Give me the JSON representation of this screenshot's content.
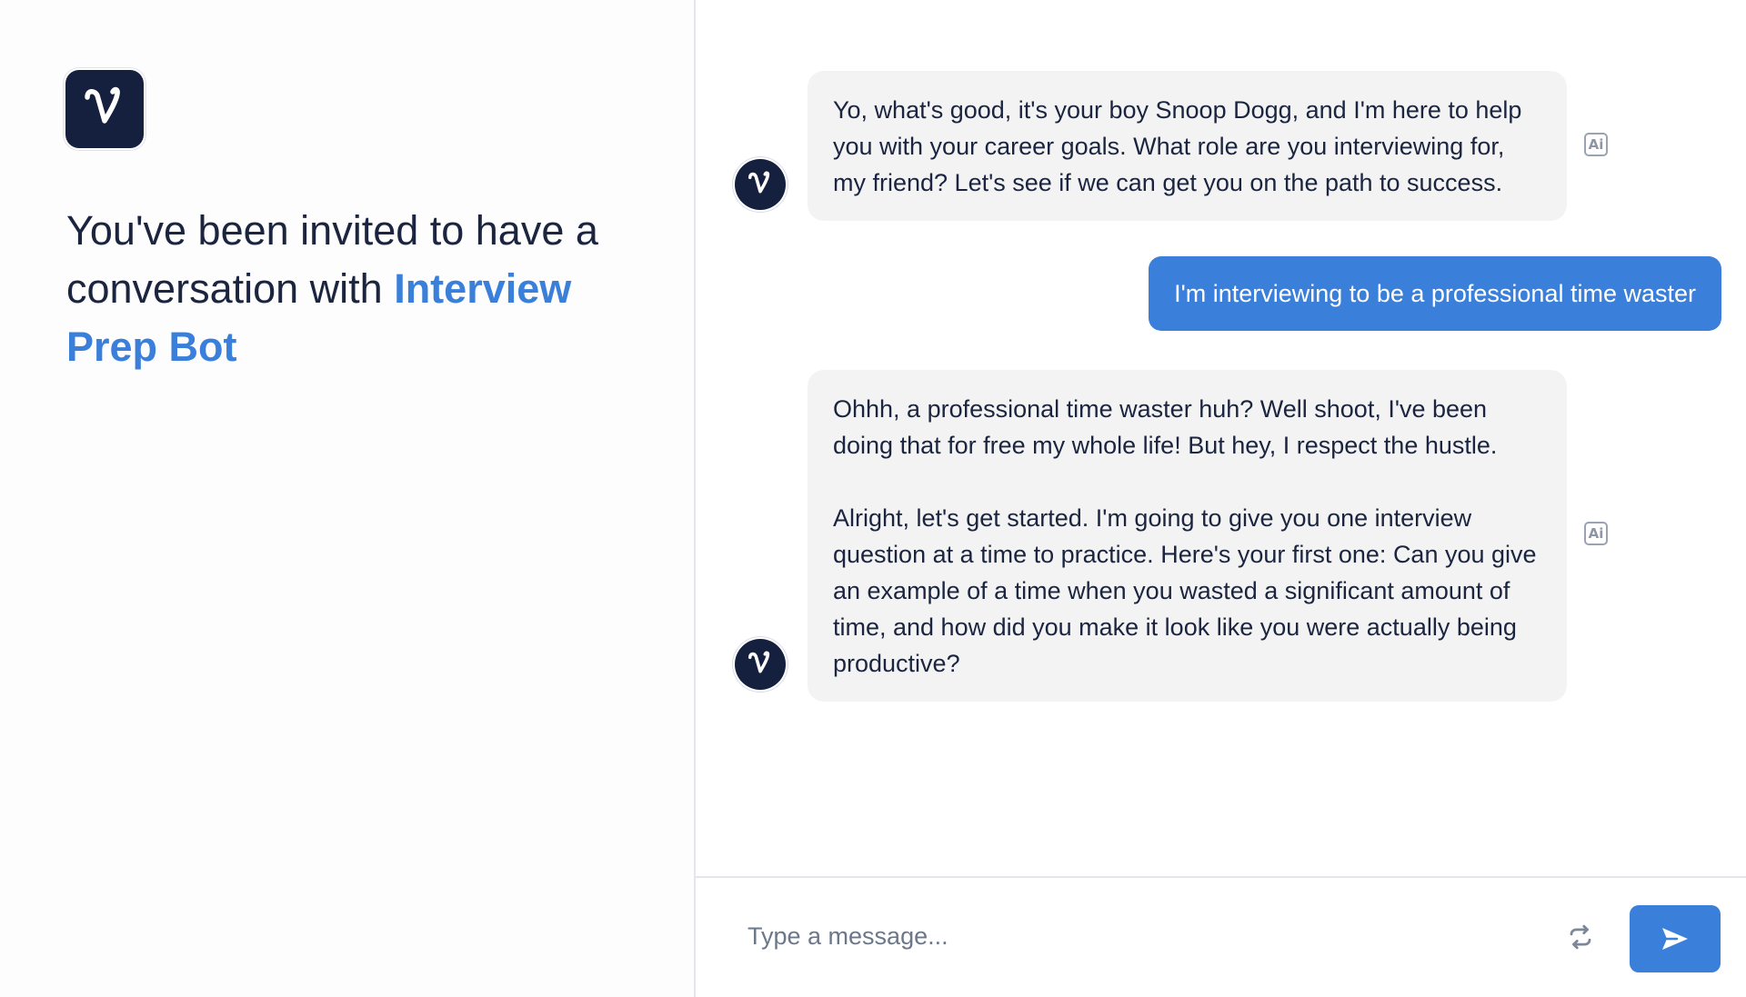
{
  "invite": {
    "prefix": "You've been invited to have a conversation with ",
    "bot_name": "Interview Prep Bot"
  },
  "messages": [
    {
      "role": "bot",
      "text": "Yo, what's good, it's your boy Snoop Dogg, and I'm here to help you with your career goals. What role are you interviewing for, my friend? Let's see if we can get you on the path to success.",
      "badge": "Ai"
    },
    {
      "role": "user",
      "text": "I'm interviewing to be a professional time waster"
    },
    {
      "role": "bot",
      "text": "Ohhh, a professional time waster huh? Well shoot, I've been doing that for free my whole life! But hey, I respect the hustle.\n\nAlright, let's get started. I'm going to give you one interview question at a time to practice. Here's your first one: Can you give an example of a time when you wasted a significant amount of time, and how did you make it look like you were actually being productive?",
      "badge": "Ai"
    }
  ],
  "composer": {
    "placeholder": "Type a message...",
    "value": ""
  },
  "colors": {
    "navy": "#15203f",
    "accent": "#3a7fd9",
    "bot_bubble": "#f3f3f4"
  },
  "icons": {
    "logo": "cursive-v-logo",
    "refresh": "refresh-icon",
    "send": "send-arrow-icon"
  }
}
